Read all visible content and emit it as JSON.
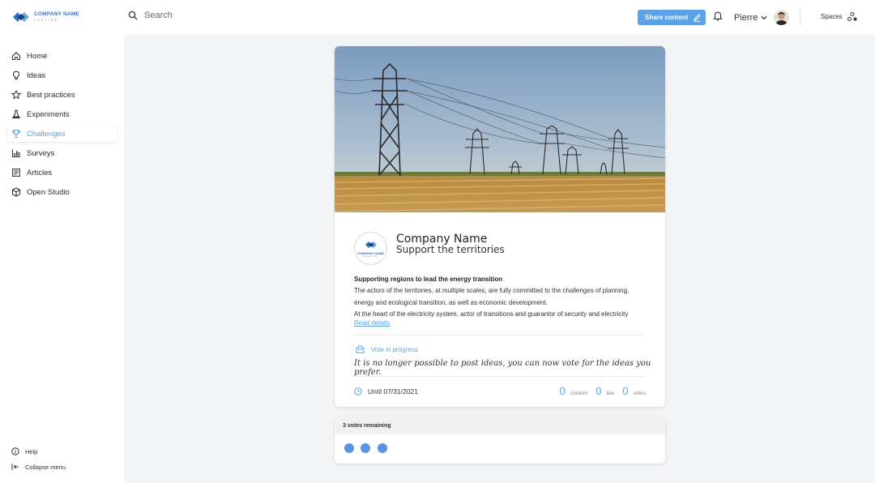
{
  "brand": {
    "name": "COMPANY NAME",
    "tagline": "TAGLINE",
    "accent": "#5ba3e6"
  },
  "header": {
    "search_placeholder": "Search",
    "share_label": "Share content",
    "user_name": "Pierre",
    "spaces_label": "Spaces"
  },
  "sidebar": {
    "items": [
      {
        "label": "Home",
        "icon": "home-icon"
      },
      {
        "label": "Ideas",
        "icon": "lightbulb-icon"
      },
      {
        "label": "Best practices",
        "icon": "star-icon"
      },
      {
        "label": "Experiments",
        "icon": "flask-icon"
      },
      {
        "label": "Challenges",
        "icon": "trophy-icon",
        "active": true
      },
      {
        "label": "Surveys",
        "icon": "bar-chart-icon"
      },
      {
        "label": "Articles",
        "icon": "article-icon"
      },
      {
        "label": "Open Studio",
        "icon": "cube-icon"
      }
    ],
    "help_label": "Help",
    "collapse_label": "Collapse menu"
  },
  "challenge": {
    "org_name": "Company Name",
    "title": "Support the territories",
    "description_title": "Supporting regions to lead the energy transition",
    "description_lines": [
      "The actors of the territories, at multiple scales, are fully committed to the challenges of planning,",
      "energy and ecological transition, as well as economic development.",
      "At the heart of the electricity system, actor of transitions and guarantor of security and electricity"
    ],
    "read_details_label": "Read details",
    "phase_label": "Vote in progress",
    "phase_note": "It is no longer possible to post ideas, you can now vote for the ideas you prefer.",
    "deadline_prefix": "Until",
    "deadline_date": "07/31/2021",
    "stats": [
      {
        "value": "0",
        "label": "content"
      },
      {
        "value": "0",
        "label": "like"
      },
      {
        "value": "0",
        "label": "votes"
      }
    ]
  },
  "votes": {
    "remaining_label": "3 votes remaining",
    "remaining_count": 3
  }
}
